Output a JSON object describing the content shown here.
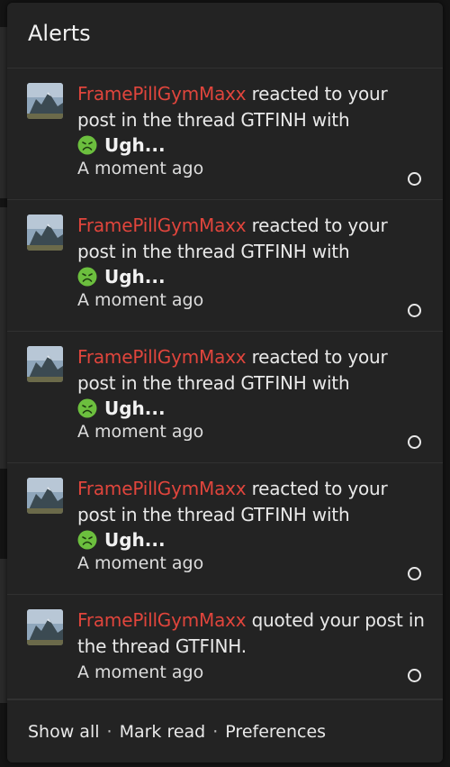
{
  "popup": {
    "title": "Alerts"
  },
  "alerts": [
    {
      "username": "FramePillGymMaxx",
      "action": " reacted to your post in the thread GTFINH with",
      "reaction": "Ugh...",
      "time": "A moment ago"
    },
    {
      "username": "FramePillGymMaxx",
      "action": " reacted to your post in the thread GTFINH with",
      "reaction": "Ugh...",
      "time": "A moment ago"
    },
    {
      "username": "FramePillGymMaxx",
      "action": " reacted to your post in the thread GTFINH with",
      "reaction": "Ugh...",
      "time": "A moment ago"
    },
    {
      "username": "FramePillGymMaxx",
      "action": " reacted to your post in the thread GTFINH with",
      "reaction": "Ugh...",
      "time": "A moment ago"
    },
    {
      "username": "FramePillGymMaxx",
      "action": " quoted your post in the thread GTFINH.",
      "time": "A moment ago"
    }
  ],
  "footer": {
    "show_all": "Show all",
    "mark_read": "Mark read",
    "preferences": "Preferences",
    "separator": "·"
  },
  "colors": {
    "username": "#e0453c",
    "popup_bg": "#232323",
    "text": "#e9e9e9"
  },
  "icons": {
    "avatar": "mountain-avatar-image",
    "reaction": "nauseated-face-icon",
    "read_marker": "unread-circle-icon"
  }
}
